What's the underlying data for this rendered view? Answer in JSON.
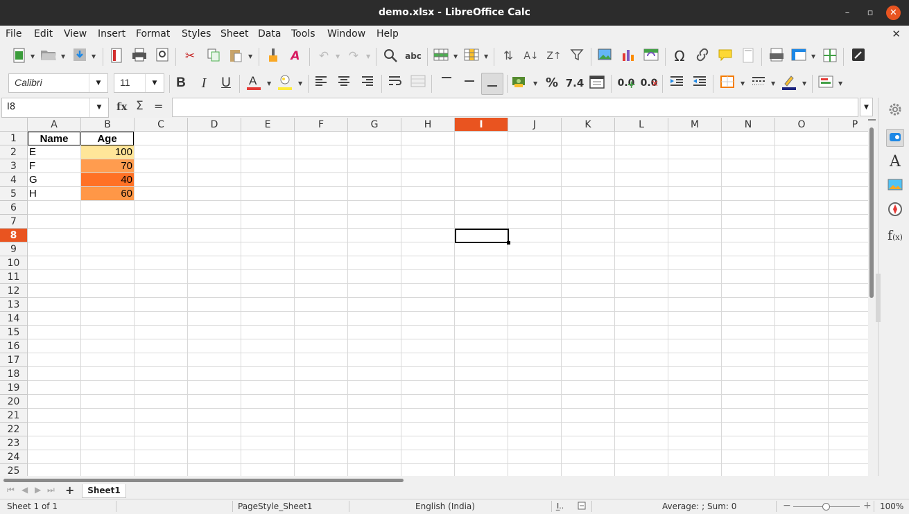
{
  "window": {
    "title": "demo.xlsx - LibreOffice Calc",
    "minimize": "–",
    "maximize": "▫",
    "close": "✕"
  },
  "menu": [
    "File",
    "Edit",
    "View",
    "Insert",
    "Format",
    "Styles",
    "Sheet",
    "Data",
    "Tools",
    "Window",
    "Help"
  ],
  "menu_close": "✕",
  "format": {
    "font_name": "Calibri",
    "font_size": "11",
    "bold": "B",
    "italic": "I",
    "underline": "U",
    "percent": "%",
    "number": "7.4",
    "add_decimal": "0.0",
    "del_decimal": "0.0"
  },
  "formula_bar": {
    "cell_ref": "I8",
    "fx": "fx",
    "sigma": "Σ",
    "equals": "=",
    "content": ""
  },
  "columns": [
    "A",
    "B",
    "C",
    "D",
    "E",
    "F",
    "G",
    "H",
    "I",
    "J",
    "K",
    "L",
    "M",
    "N",
    "O",
    "P"
  ],
  "selected_column": "I",
  "rows": [
    "1",
    "2",
    "3",
    "4",
    "5",
    "6",
    "7",
    "8",
    "9",
    "10",
    "11",
    "12",
    "13",
    "14",
    "15",
    "16",
    "17",
    "18",
    "19",
    "20",
    "21",
    "22",
    "23",
    "24",
    "25"
  ],
  "selected_row": "8",
  "cells": {
    "header_name": "Name",
    "header_age": "Age",
    "data": [
      {
        "name": "E",
        "age": "100",
        "color": "#ffe699"
      },
      {
        "name": "F",
        "age": "70",
        "color": "#ff9c4f"
      },
      {
        "name": "G",
        "age": "40",
        "color": "#ff7125"
      },
      {
        "name": "H",
        "age": "60",
        "color": "#ff9747"
      }
    ]
  },
  "sheet_tab": "Sheet1",
  "add_sheet": "+",
  "status": {
    "sheet": "Sheet 1 of 1",
    "page_style": "PageStyle_Sheet1",
    "language": "English (India)",
    "summary": "Average: ; Sum: 0",
    "zoom": "100%",
    "zoom_minus": "−",
    "zoom_plus": "+"
  },
  "colors": {
    "accent": "#e95420"
  }
}
